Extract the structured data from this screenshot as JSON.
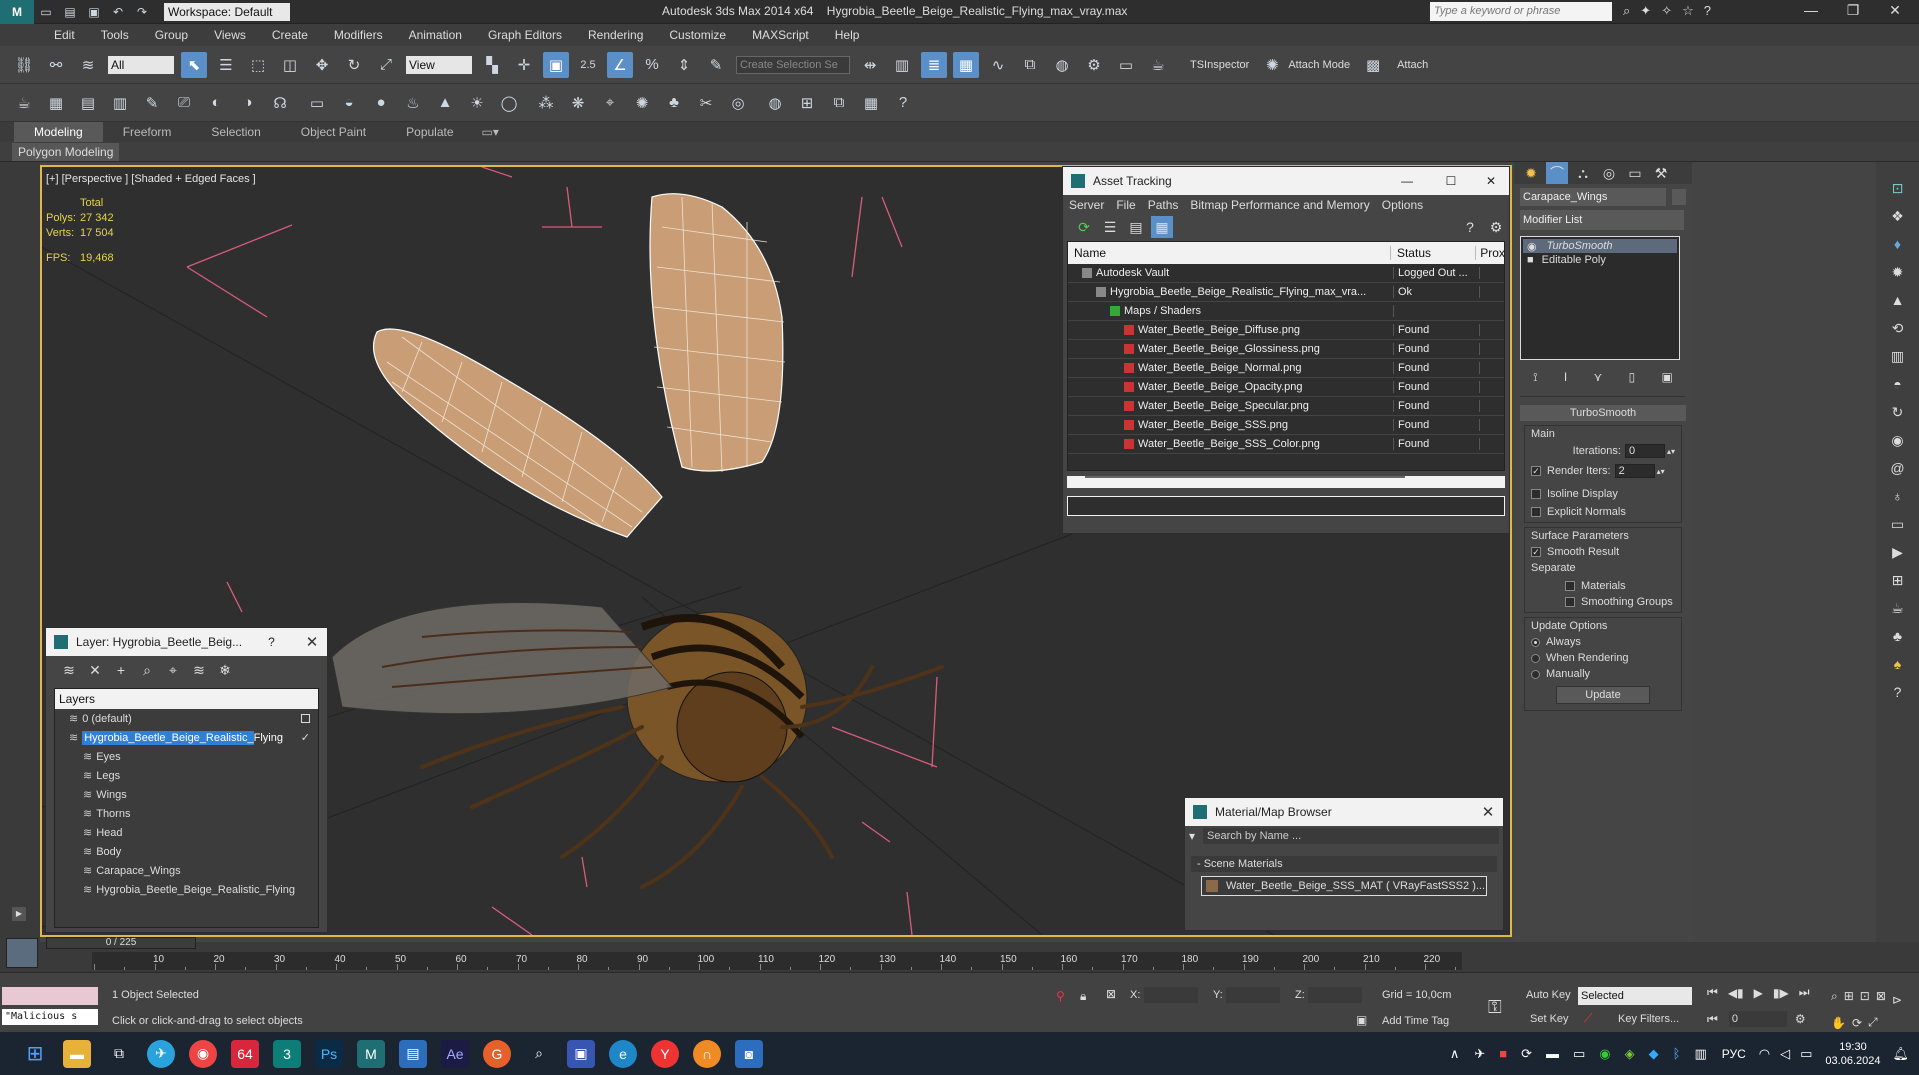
{
  "window": {
    "app_title": "Autodesk 3ds Max  2014 x64",
    "file_title": "Hygrobia_Beetle_Beige_Realistic_Flying_max_vray.max",
    "workspace": "Workspace: Default",
    "search_placeholder": "Type a keyword or phrase"
  },
  "menu": [
    "Edit",
    "Tools",
    "Group",
    "Views",
    "Create",
    "Modifiers",
    "Animation",
    "Graph Editors",
    "Rendering",
    "Customize",
    "MAXScript",
    "Help"
  ],
  "toolbar": {
    "filter": "All",
    "ref_coord": "View",
    "snap_value": "2.5",
    "selection_set_placeholder": "Create Selection Se",
    "tsinspector": "TSInspector",
    "attach_mode": "Attach Mode",
    "attach": "Attach"
  },
  "ribbon": {
    "tabs": [
      "Modeling",
      "Freeform",
      "Selection",
      "Object Paint",
      "Populate"
    ],
    "active": "Modeling",
    "subtitle": "Polygon Modeling"
  },
  "viewport": {
    "label": "[+] [Perspective ] [Shaded + Edged Faces ]",
    "stats_header": "Total",
    "polys_label": "Polys:",
    "polys_value": "27 342",
    "verts_label": "Verts:",
    "verts_value": "17 504",
    "fps_label": "FPS:",
    "fps_value": "19,468"
  },
  "asset_tracking": {
    "title": "Asset Tracking",
    "menu": [
      "Server",
      "File",
      "Paths",
      "Bitmap Performance and Memory",
      "Options"
    ],
    "columns": [
      "Name",
      "Status",
      "Prox"
    ],
    "rows": [
      {
        "name": "Autodesk Vault",
        "status": "Logged Out ...",
        "indent": 0
      },
      {
        "name": "Hygrobia_Beetle_Beige_Realistic_Flying_max_vra...",
        "status": "Ok",
        "indent": 1
      },
      {
        "name": "Maps / Shaders",
        "status": "",
        "indent": 2
      },
      {
        "name": "Water_Beetle_Beige_Diffuse.png",
        "status": "Found",
        "indent": 3
      },
      {
        "name": "Water_Beetle_Beige_Glossiness.png",
        "status": "Found",
        "indent": 3
      },
      {
        "name": "Water_Beetle_Beige_Normal.png",
        "status": "Found",
        "indent": 3
      },
      {
        "name": "Water_Beetle_Beige_Opacity.png",
        "status": "Found",
        "indent": 3
      },
      {
        "name": "Water_Beetle_Beige_Specular.png",
        "status": "Found",
        "indent": 3
      },
      {
        "name": "Water_Beetle_Beige_SSS.png",
        "status": "Found",
        "indent": 3
      },
      {
        "name": "Water_Beetle_Beige_SSS_Color.png",
        "status": "Found",
        "indent": 3
      }
    ]
  },
  "layer_window": {
    "title": "Layer: Hygrobia_Beetle_Beig...",
    "help": "?",
    "header": "Layers",
    "items": [
      {
        "name": "0 (default)",
        "indent": 1,
        "selected": false
      },
      {
        "name": "Hygrobia_Beetle_Beige_Realistic_Flying",
        "indent": 1,
        "selected": true
      },
      {
        "name": "Eyes",
        "indent": 2,
        "selected": false
      },
      {
        "name": "Legs",
        "indent": 2,
        "selected": false
      },
      {
        "name": "Wings",
        "indent": 2,
        "selected": false
      },
      {
        "name": "Thorns",
        "indent": 2,
        "selected": false
      },
      {
        "name": "Head",
        "indent": 2,
        "selected": false
      },
      {
        "name": "Body",
        "indent": 2,
        "selected": false
      },
      {
        "name": "Carapace_Wings",
        "indent": 2,
        "selected": false
      },
      {
        "name": "Hygrobia_Beetle_Beige_Realistic_Flying",
        "indent": 2,
        "selected": false
      }
    ]
  },
  "material_browser": {
    "title": "Material/Map Browser",
    "search_placeholder": "Search by Name ...",
    "section": "- Scene Materials",
    "material": "Water_Beetle_Beige_SSS_MAT  ( VRayFastSSS2 )..."
  },
  "command_panel": {
    "object_name": "Carapace_Wings",
    "modifier_list": "Modifier List",
    "stack": [
      "TurboSmooth",
      "Editable Poly"
    ],
    "rollout_title": "TurboSmooth",
    "main_label": "Main",
    "iterations_label": "Iterations:",
    "iterations_value": "0",
    "render_iters_label": "Render Iters:",
    "render_iters_value": "2",
    "isoline": "Isoline Display",
    "explicit_normals": "Explicit Normals",
    "surface_params": "Surface Parameters",
    "smooth_result": "Smooth Result",
    "separate": "Separate",
    "materials": "Materials",
    "smoothing_groups": "Smoothing Groups",
    "update_options": "Update Options",
    "always": "Always",
    "when_rendering": "When Rendering",
    "manually": "Manually",
    "update_button": "Update"
  },
  "timeline": {
    "frame": "0 / 225",
    "ticks": [
      "10",
      "20",
      "30",
      "40",
      "50",
      "60",
      "70",
      "80",
      "90",
      "100",
      "110",
      "120",
      "130",
      "140",
      "150",
      "160",
      "170",
      "180",
      "190",
      "200",
      "210",
      "220"
    ]
  },
  "status": {
    "maxscript": "\"Malicious s",
    "selected": "1 Object Selected",
    "prompt": "Click or click-and-drag to select objects",
    "x_label": "X:",
    "y_label": "Y:",
    "z_label": "Z:",
    "grid": "Grid = 10,0cm",
    "add_time_tag": "Add Time Tag",
    "auto_key": "Auto Key",
    "set_key": "Set Key",
    "selected_dropdown": "Selected",
    "key_filters": "Key Filters...",
    "frame_value": "0"
  },
  "taskbar": {
    "time": "19:30",
    "date": "03.06.2024",
    "lang": "РУС",
    "badge_64": "64"
  }
}
